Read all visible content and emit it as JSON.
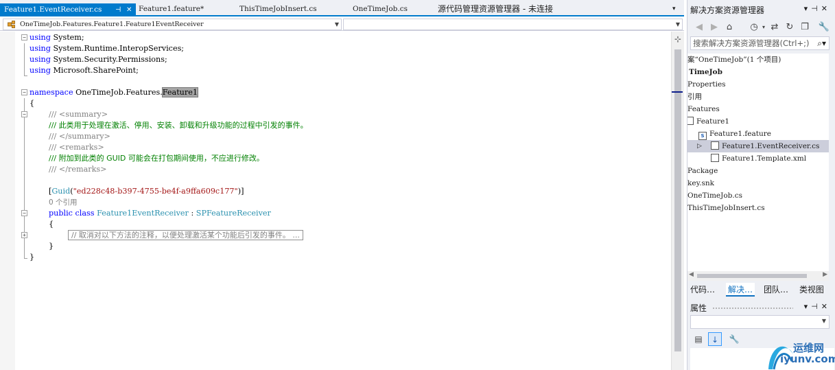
{
  "tabs": [
    {
      "label": "Feature1.EventReceiver.cs",
      "active": true
    },
    {
      "label": "Feature1.feature*"
    },
    {
      "label": "ThisTimeJobInsert.cs"
    },
    {
      "label": "OneTimeJob.cs"
    },
    {
      "label": "源代码管理资源管理器 - 未连接"
    }
  ],
  "navbar": {
    "type_combo": "OneTimeJob.Features.Feature1.Feature1EventReceiver",
    "member_combo": ""
  },
  "code": {
    "using1_kw": "using",
    "using1_ns": " System;",
    "using2_kw": "using",
    "using2_ns": " System.Runtime.InteropServices;",
    "using3_kw": "using",
    "using3_ns": " System.Security.Permissions;",
    "using4_kw": "using",
    "using4_ns": " Microsoft.SharePoint;",
    "ns_kw": "namespace",
    "ns_name": " OneTimeJob.Features.",
    "ns_last": "Feature1",
    "brace_open": "{",
    "doc1_slash": "/// ",
    "doc1_tag": "<summary>",
    "doc2": "/// 此类用于处理在激活、停用、安装、卸载和升级功能的过程中引发的事件。",
    "doc3_slash": "/// ",
    "doc3_tag": "</summary>",
    "doc4_slash": "/// ",
    "doc4_tag": "<remarks>",
    "doc5": "/// 附加到此类的 GUID 可能会在打包期间使用，不应进行修改。",
    "doc6_slash": "/// ",
    "doc6_tag": "</remarks>",
    "attr_open": "[",
    "attr_name": "Guid",
    "attr_paren_open": "(",
    "attr_value": "\"ed228c48-b397-4755-be4f-a9ffa609c177\"",
    "attr_close": ")]",
    "refs": "0 个引用",
    "class_public": "public",
    "class_class": " class ",
    "class_name": "Feature1EventReceiver",
    "class_colon": " : ",
    "class_base": "SPFeatureReceiver",
    "class_brace_open": "{",
    "collapsed_region": "// 取消对以下方法的注释，以便处理激活某个功能后引发的事件。 ...",
    "class_brace_close": "}",
    "brace_close": "}"
  },
  "solution_explorer": {
    "title": "解决方案资源管理器",
    "search_placeholder": "搜索解决方案资源管理器(Ctrl+;)",
    "items": [
      {
        "label": "案“OneTimeJob”(1 个项目)"
      },
      {
        "label": "TimeJob"
      },
      {
        "label": "Properties"
      },
      {
        "label": "引用"
      },
      {
        "label": "Features"
      },
      {
        "label": "Feature1"
      },
      {
        "label": "Feature1.feature"
      },
      {
        "label": "Feature1.EventReceiver.cs",
        "selected": true
      },
      {
        "label": "Feature1.Template.xml"
      },
      {
        "label": "Package"
      },
      {
        "label": "key.snk"
      },
      {
        "label": "OneTimeJob.cs"
      },
      {
        "label": "ThisTimeJobInsert.cs"
      }
    ],
    "bottom_tabs": [
      {
        "label": "代码…"
      },
      {
        "label": "解决…",
        "active": true
      },
      {
        "label": "团队…"
      },
      {
        "label": "类视图"
      }
    ]
  },
  "properties": {
    "title": "属性"
  },
  "watermark": {
    "line1": "运维网",
    "line2": "iyunv.com"
  },
  "colors": {
    "accent": "#007acc",
    "keyword": "#0000ff",
    "comment": "#008000",
    "type": "#2b91af",
    "string": "#a31515",
    "selection": "#cccedb"
  }
}
